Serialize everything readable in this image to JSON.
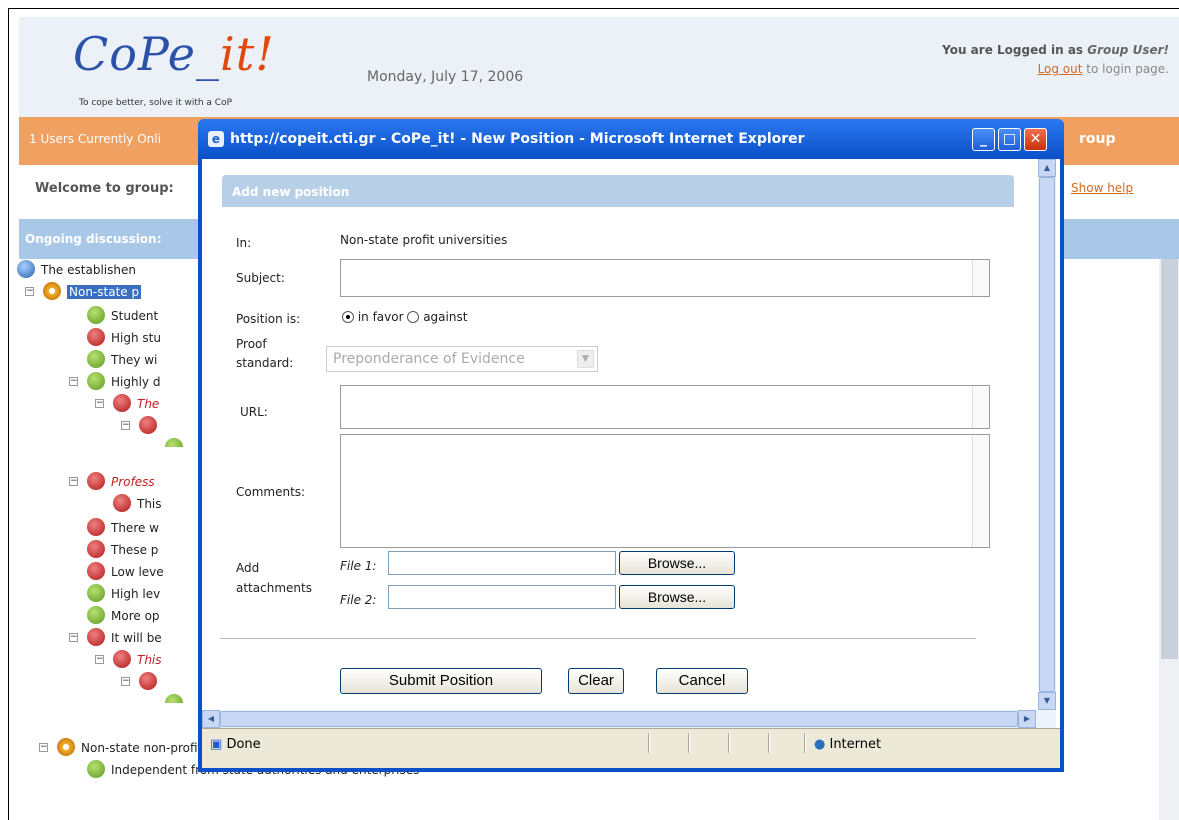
{
  "header": {
    "logo_text": "CoPe_it!",
    "logo_tagline": "To cope better, solve it with a CoP",
    "date": "Monday, July 17, 2006",
    "logged_in_prefix": "You are Logged in as",
    "user": "Group User!",
    "logout_link": "Log out",
    "logout_suffix": "to login page."
  },
  "bar": {
    "users_online": "1 Users Currently Onli",
    "group_suffix": "roup"
  },
  "welcome": "Welcome to group:",
  "show_help": "Show help",
  "ongoing_label": "Ongoing discussion:",
  "tree": [
    {
      "text": "The establishen",
      "icon": "globe",
      "style": "normal"
    },
    {
      "text": "Non-state p",
      "icon": "gear",
      "style": "highlight"
    },
    {
      "text": "Student",
      "icon": "plus",
      "style": "normal"
    },
    {
      "text": "High stu",
      "icon": "minus",
      "style": "normal"
    },
    {
      "text": "They wi",
      "icon": "plus",
      "style": "normal"
    },
    {
      "text": "Highly d",
      "icon": "plus",
      "style": "normal"
    },
    {
      "text": "The",
      "icon": "minus",
      "style": "red"
    },
    {
      "text": "",
      "icon": "minus",
      "style": "normal"
    },
    {
      "text": "",
      "icon": "plus",
      "style": "normal"
    },
    {
      "text": "Profess",
      "icon": "minus",
      "style": "red"
    },
    {
      "text": "This",
      "icon": "minus",
      "style": "normal"
    },
    {
      "text": "There w",
      "icon": "minus",
      "style": "normal"
    },
    {
      "text": "These p",
      "icon": "minus",
      "style": "normal"
    },
    {
      "text": "Low leve",
      "icon": "minus",
      "style": "normal"
    },
    {
      "text": "High lev",
      "icon": "plus",
      "style": "normal"
    },
    {
      "text": "More op",
      "icon": "plus",
      "style": "normal"
    },
    {
      "text": "It will be",
      "icon": "minus",
      "style": "normal"
    },
    {
      "text": "This",
      "icon": "minus",
      "style": "red"
    },
    {
      "text": "",
      "icon": "minus",
      "style": "normal"
    },
    {
      "text": "",
      "icon": "plus",
      "style": "normal"
    },
    {
      "text": "Non-state non-profit universities",
      "icon": "gear",
      "style": "normal"
    },
    {
      "text": "Independent from state authorities and enterprises",
      "icon": "plus",
      "style": "normal"
    }
  ],
  "dialog": {
    "title": "http://copeit.cti.gr - CoPe_it! - New Position - Microsoft Internet Explorer",
    "form_header": "Add new position",
    "in_label": "In:",
    "in_value": "Non-state profit universities",
    "subject_label": "Subject:",
    "position_label": "Position is:",
    "in_favor": "in favor",
    "against": "against",
    "proof_label": "Proof standard:",
    "proof_value": "Preponderance of Evidence",
    "url_label": "URL:",
    "comments_label": "Comments:",
    "attachments_label": "Add attachments",
    "file1_label": "File 1:",
    "file2_label": "File 2:",
    "browse_label": "Browse...",
    "submit_label": "Submit Position",
    "clear_label": "Clear",
    "cancel_label": "Cancel",
    "status_done": "Done",
    "status_zone": "Internet"
  }
}
